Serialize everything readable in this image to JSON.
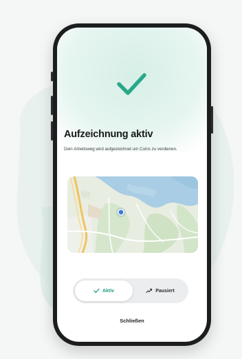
{
  "page": {
    "title": "Aufzeichnung aktiv",
    "description": "Dein Arbeitsweg wird aufgezeichnet um Coins zu verdienen."
  },
  "tracking_toggle": {
    "active_label": "Aktiv",
    "paused_label": "Pausiert",
    "selected": "Aktiv"
  },
  "close_label": "Schließen",
  "icons": {
    "status": "checkmark-icon",
    "active": "check-icon",
    "paused": "pause-graph-icon",
    "location": "location-dot-icon"
  },
  "colors": {
    "accent": "#2aa889",
    "glow": "#d7efe7",
    "location": "#3a7bd5"
  }
}
